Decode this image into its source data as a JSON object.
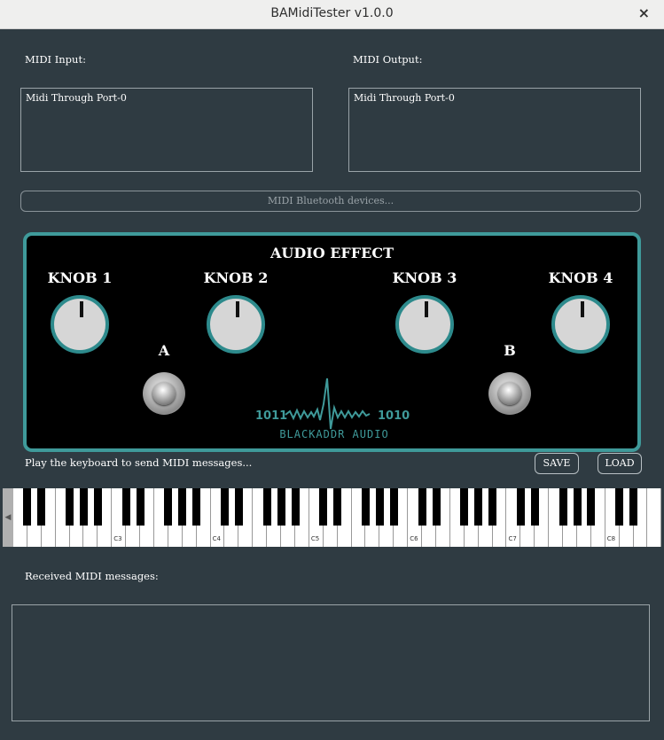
{
  "window": {
    "title": "BAMidiTester v1.0.0",
    "close_glyph": "×"
  },
  "midi_input": {
    "label": "MIDI Input:",
    "items": [
      "Midi Through Port-0"
    ]
  },
  "midi_output": {
    "label": "MIDI Output:",
    "items": [
      "Midi Through Port-0"
    ]
  },
  "bluetooth_button": "MIDI Bluetooth devices...",
  "pedal": {
    "title": "AUDIO EFFECT",
    "knobs": [
      "KNOB 1",
      "KNOB 2",
      "KNOB 3",
      "KNOB 4"
    ],
    "switches": [
      "A",
      "B"
    ],
    "logo_left": "1011",
    "logo_right": "1010",
    "brand": "BLACKADDR AUDIO",
    "accent_color": "#3f9a9a"
  },
  "play_text": "Play the keyboard to send MIDI messages...",
  "buttons": {
    "save": "SAVE",
    "load": "LOAD"
  },
  "keyboard": {
    "octave_labels": [
      "C3",
      "C4",
      "C5",
      "C6",
      "C7",
      "C8"
    ]
  },
  "received": {
    "label": "Received MIDI messages:"
  }
}
